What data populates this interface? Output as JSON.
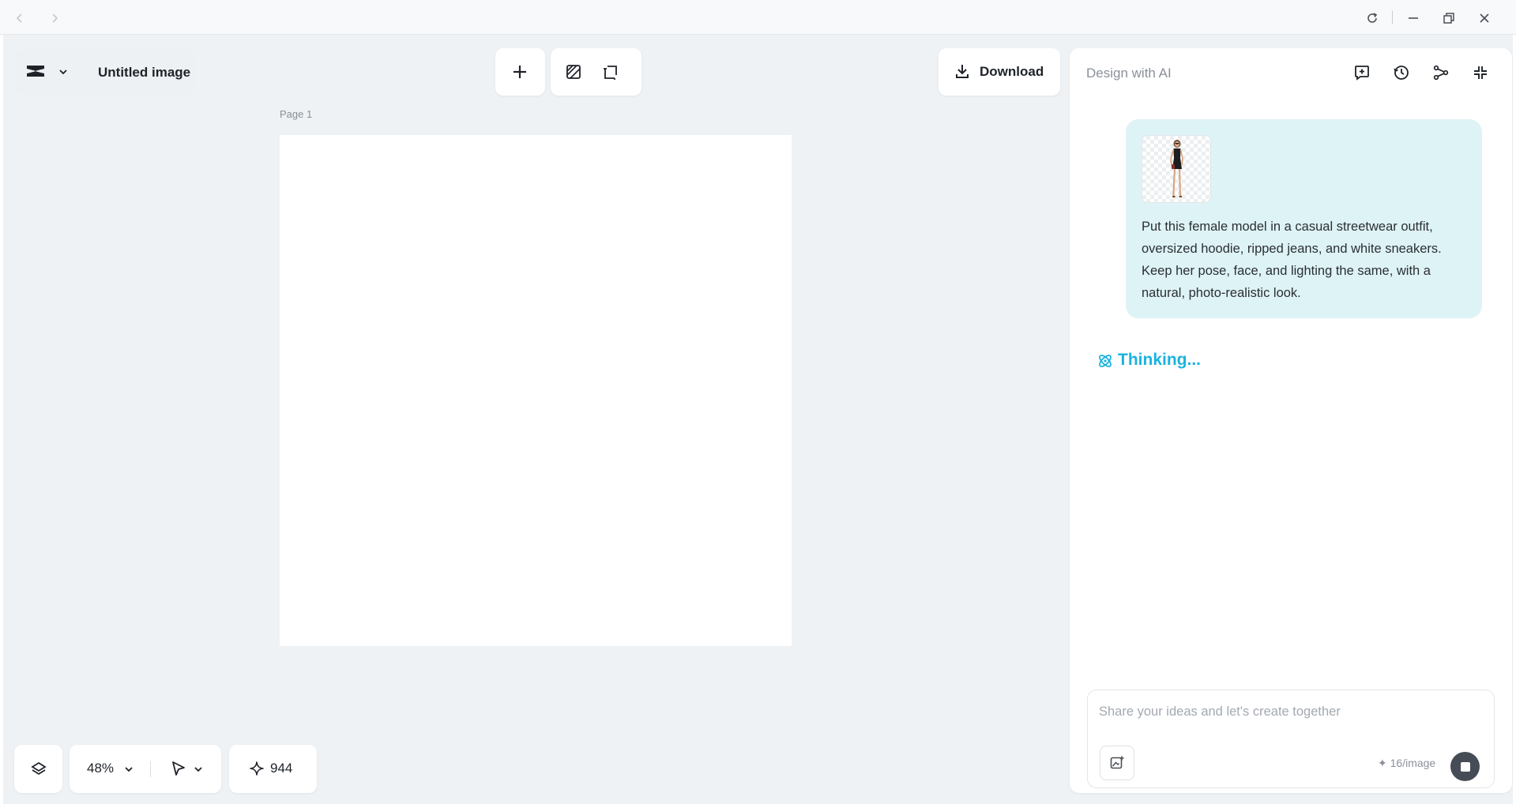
{
  "window": {
    "controls": [
      "back-icon",
      "forward-icon",
      "reload-icon",
      "minimize-icon",
      "restore-icon",
      "close-icon"
    ]
  },
  "document": {
    "title": "Untitled image",
    "page_label": "Page 1"
  },
  "toolbar": {
    "download_label": "Download"
  },
  "bottom_bar": {
    "zoom": "48%",
    "credits": "944"
  },
  "ai_panel": {
    "title": "Design with AI",
    "header_icons": [
      "new-chat-icon",
      "history-icon",
      "share-icon",
      "collapse-icon"
    ],
    "user_message": "Put this female model in a casual streetwear outfit, oversized hoodie, ripped jeans, and white sneakers. Keep her pose, face, and lighting the same, with a natural, photo-realistic look.",
    "status": "Thinking...",
    "composer_placeholder": "Share your ideas and let's create together",
    "cost_label": "16/image"
  },
  "colors": {
    "accent": "#1bb3df",
    "bubble": "#def3f6",
    "workspace": "#eef2f5",
    "stop_button": "#454c56"
  }
}
